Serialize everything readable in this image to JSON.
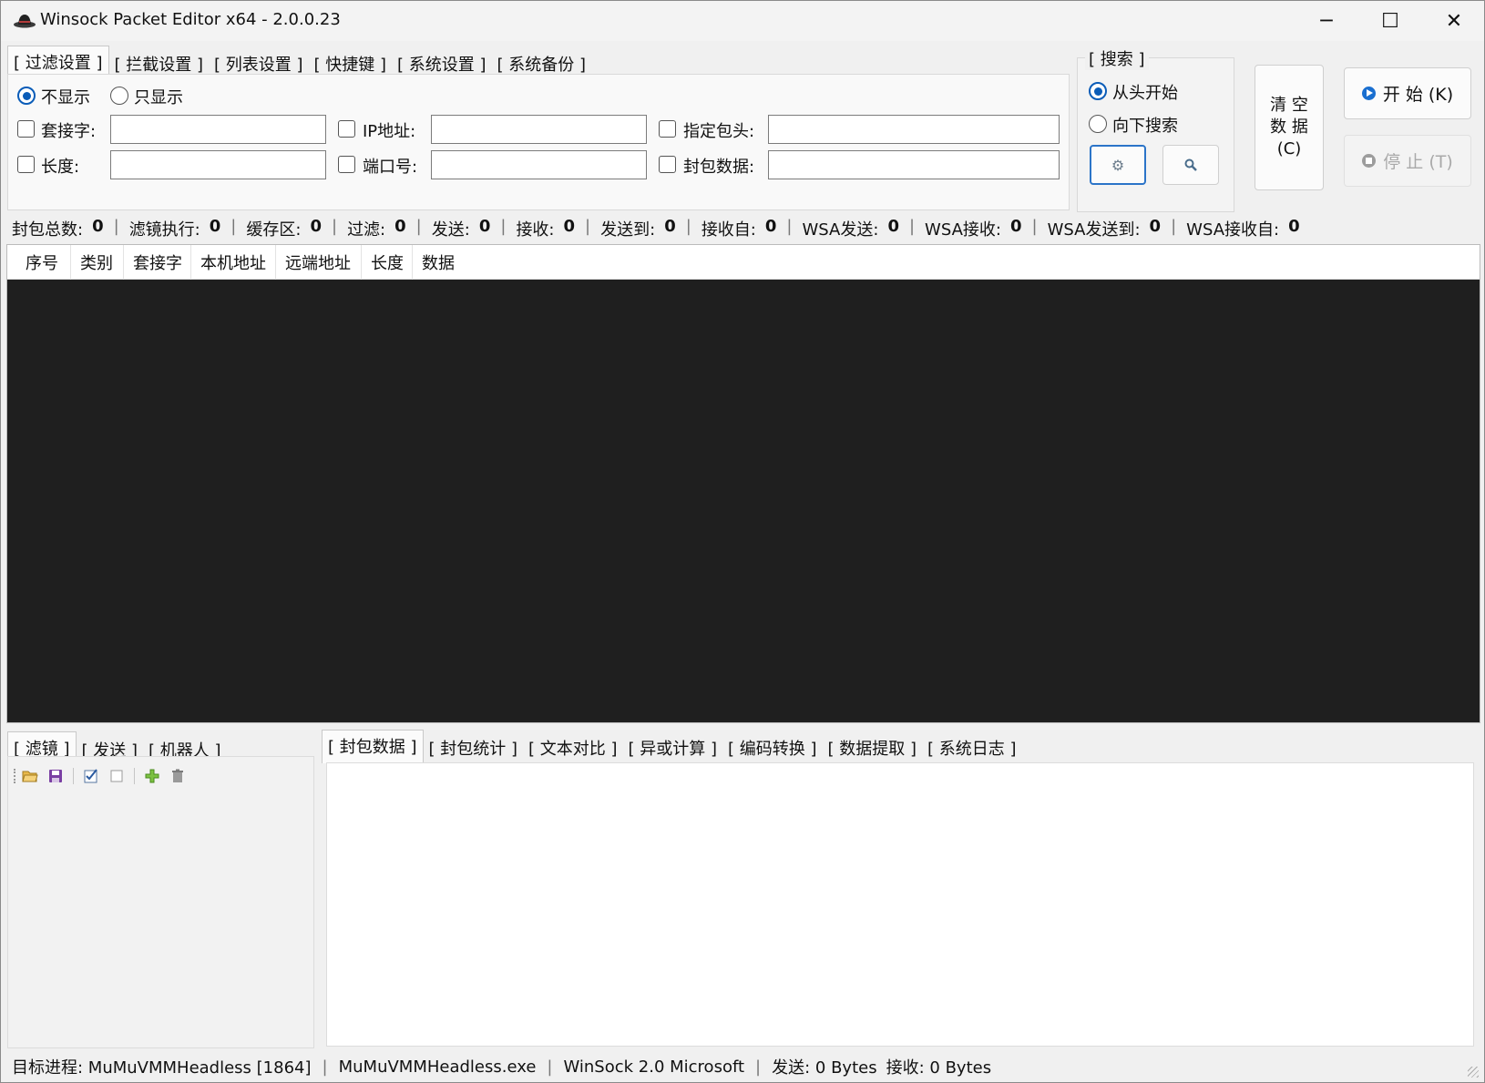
{
  "window": {
    "title": "Winsock Packet Editor x64 - 2.0.0.23",
    "controls": {
      "minimize": "─",
      "maximize": "☐",
      "close": "✕"
    }
  },
  "top_tabs": [
    {
      "label": "[ 过滤设置 ]",
      "active": true
    },
    {
      "label": "[ 拦截设置 ]"
    },
    {
      "label": "[ 列表设置 ]"
    },
    {
      "label": "[ 快捷键 ]"
    },
    {
      "label": "[ 系统设置 ]"
    },
    {
      "label": "[ 系统备份 ]"
    }
  ],
  "filter": {
    "mode_hide": "不显示",
    "mode_only": "只显示",
    "socket_label": "套接字:",
    "length_label": "长度:",
    "ip_label": "IP地址:",
    "port_label": "端口号:",
    "header_label": "指定包头:",
    "data_label": "封包数据:",
    "socket_value": "",
    "length_value": "",
    "ip_value": "",
    "port_value": "",
    "header_value": "",
    "data_value": ""
  },
  "search": {
    "title": "[ 搜索 ]",
    "from_start": "从头开始",
    "search_down": "向下搜索"
  },
  "buttons": {
    "clear": "清 空 数 据 (C)",
    "start": "开 始 (K)",
    "stop": "停 止 (T)"
  },
  "stats": [
    {
      "label": "封包总数:",
      "value": "0"
    },
    {
      "label": "滤镜执行:",
      "value": "0"
    },
    {
      "label": "缓存区:",
      "value": "0"
    },
    {
      "label": "过滤:",
      "value": "0"
    },
    {
      "label": "发送:",
      "value": "0"
    },
    {
      "label": "接收:",
      "value": "0"
    },
    {
      "label": "发送到:",
      "value": "0"
    },
    {
      "label": "接收自:",
      "value": "0"
    },
    {
      "label": "WSA发送:",
      "value": "0"
    },
    {
      "label": "WSA接收:",
      "value": "0"
    },
    {
      "label": "WSA发送到:",
      "value": "0"
    },
    {
      "label": "WSA接收自:",
      "value": "0"
    }
  ],
  "packet_list": {
    "columns": [
      "序号",
      "类别",
      "套接字",
      "本机地址",
      "远端地址",
      "长度",
      "数据"
    ],
    "rows": []
  },
  "bottom_left_tabs": [
    {
      "label": "[ 滤镜 ]",
      "active": true
    },
    {
      "label": "[ 发送 ]"
    },
    {
      "label": "[ 机器人 ]"
    }
  ],
  "bottom_right_tabs": [
    {
      "label": "[ 封包数据 ]",
      "active": true
    },
    {
      "label": "[ 封包统计 ]"
    },
    {
      "label": "[ 文本对比 ]"
    },
    {
      "label": "[ 异或计算 ]"
    },
    {
      "label": "[ 编码转换 ]"
    },
    {
      "label": "[ 数据提取 ]"
    },
    {
      "label": "[ 系统日志 ]"
    }
  ],
  "toolbar_icons": [
    "open-folder-icon",
    "save-icon",
    "check-all-icon",
    "uncheck-all-icon",
    "add-icon",
    "delete-icon"
  ],
  "statusbar": {
    "process": "目标进程: MuMuVMMHeadless [1864]",
    "exe": "MuMuVMMHeadless.exe",
    "winsock": "WinSock 2.0 Microsoft",
    "sent": "发送: 0 Bytes",
    "received": "接收: 0 Bytes"
  },
  "colors": {
    "accent": "#0a5cb8",
    "list_bg": "#1f1f1f",
    "window_bg": "#f0f0f0"
  }
}
